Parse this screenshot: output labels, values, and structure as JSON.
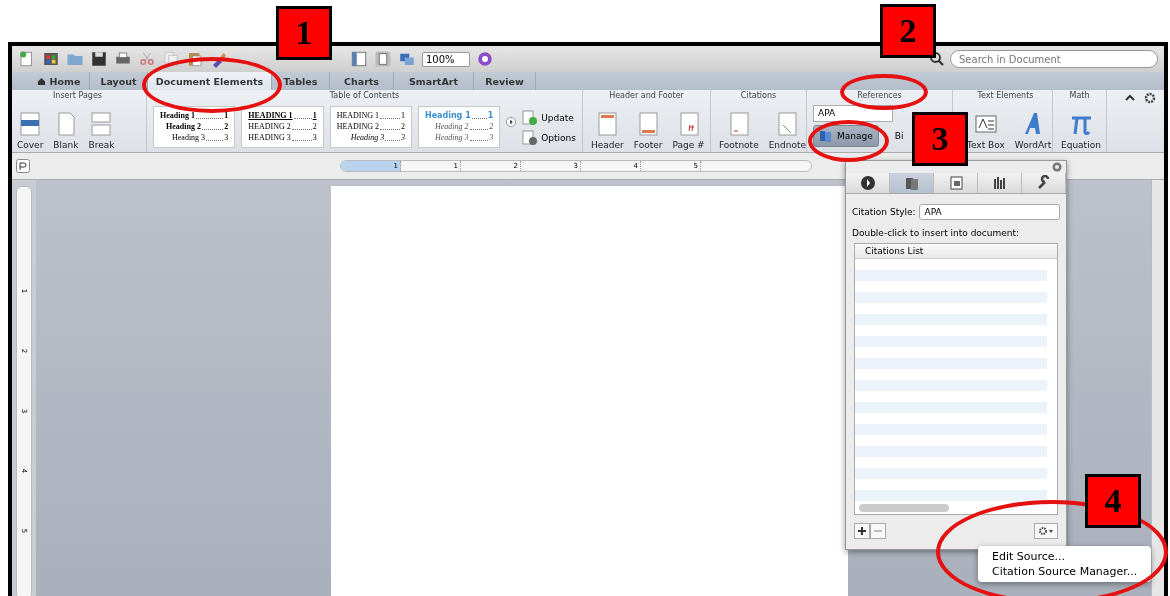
{
  "callouts": [
    {
      "label": "1"
    },
    {
      "label": "2"
    },
    {
      "label": "3"
    },
    {
      "label": "4"
    }
  ],
  "toolbar": {
    "zoom": "100%"
  },
  "search": {
    "placeholder": "Search in Document"
  },
  "tabs": [
    {
      "label": "Home",
      "selected": false
    },
    {
      "label": "Layout",
      "selected": false
    },
    {
      "label": "Document Elements",
      "selected": true
    },
    {
      "label": "Tables",
      "selected": false
    },
    {
      "label": "Charts",
      "selected": false
    },
    {
      "label": "SmartArt",
      "selected": false
    },
    {
      "label": "Review",
      "selected": false
    }
  ],
  "ribbon": {
    "groups": [
      {
        "title": "Insert Pages",
        "items": [
          {
            "kind": "button",
            "label": "Cover"
          },
          {
            "kind": "button",
            "label": "Blank"
          },
          {
            "kind": "button",
            "label": "Break"
          }
        ]
      },
      {
        "title": "Table of Contents",
        "items": [
          {
            "kind": "toc",
            "lines": [
              {
                "text": "Heading 1",
                "page": "1"
              },
              {
                "text": "Heading 2",
                "page": "2"
              },
              {
                "text": "Heading 3",
                "page": "3"
              }
            ]
          },
          {
            "kind": "toc",
            "lines": [
              {
                "text": "HEADING 1",
                "page": "1"
              },
              {
                "text": "HEADING 2",
                "page": "2"
              },
              {
                "text": "HEADING 3",
                "page": "3"
              }
            ]
          },
          {
            "kind": "toc",
            "lines": [
              {
                "text": "HEADING 1",
                "page": "1"
              },
              {
                "text": "HEADING 2",
                "page": "2"
              },
              {
                "text": "Heading 3",
                "page": "3"
              }
            ]
          },
          {
            "kind": "toc",
            "lines": [
              {
                "text": "Heading 1",
                "page": "1"
              },
              {
                "text": "Heading 2",
                "page": "2"
              },
              {
                "text": "Heading 3",
                "page": "3"
              }
            ]
          },
          {
            "kind": "stack",
            "buttons": [
              "Update",
              "Options"
            ]
          }
        ]
      },
      {
        "title": "Header and Footer",
        "items": [
          {
            "kind": "button",
            "label": "Header"
          },
          {
            "kind": "button",
            "label": "Footer"
          },
          {
            "kind": "button",
            "label": "Page #"
          }
        ]
      },
      {
        "title": "Citations",
        "items": [
          {
            "kind": "button",
            "label": "Footnote"
          },
          {
            "kind": "button",
            "label": "Endnote"
          }
        ]
      },
      {
        "title": "References",
        "items": [
          {
            "kind": "references",
            "style": "APA",
            "manage": "Manage",
            "bib": "Bi"
          }
        ]
      },
      {
        "title": "Text Elements",
        "items": [
          {
            "kind": "button",
            "label": "Text Box"
          },
          {
            "kind": "button",
            "label": "WordArt"
          }
        ]
      },
      {
        "title": "Math",
        "items": [
          {
            "kind": "button",
            "label": "Equation"
          }
        ]
      }
    ]
  },
  "ruler": {
    "marks": [
      "1",
      "1",
      "2",
      "3",
      "4",
      "5"
    ],
    "vertical_marks": [
      "1",
      "2",
      "3",
      "4",
      "5"
    ]
  },
  "panel": {
    "tabs": [
      {
        "selected": false
      },
      {
        "selected": true
      },
      {
        "selected": false
      },
      {
        "selected": false
      },
      {
        "selected": false
      }
    ],
    "style_label": "Citation Style:",
    "style_value": "APA",
    "instruction": "Double-click to insert into document:",
    "list_header": "Citations List"
  },
  "menu": {
    "items": [
      "Edit Source...",
      "Citation Source Manager..."
    ]
  }
}
